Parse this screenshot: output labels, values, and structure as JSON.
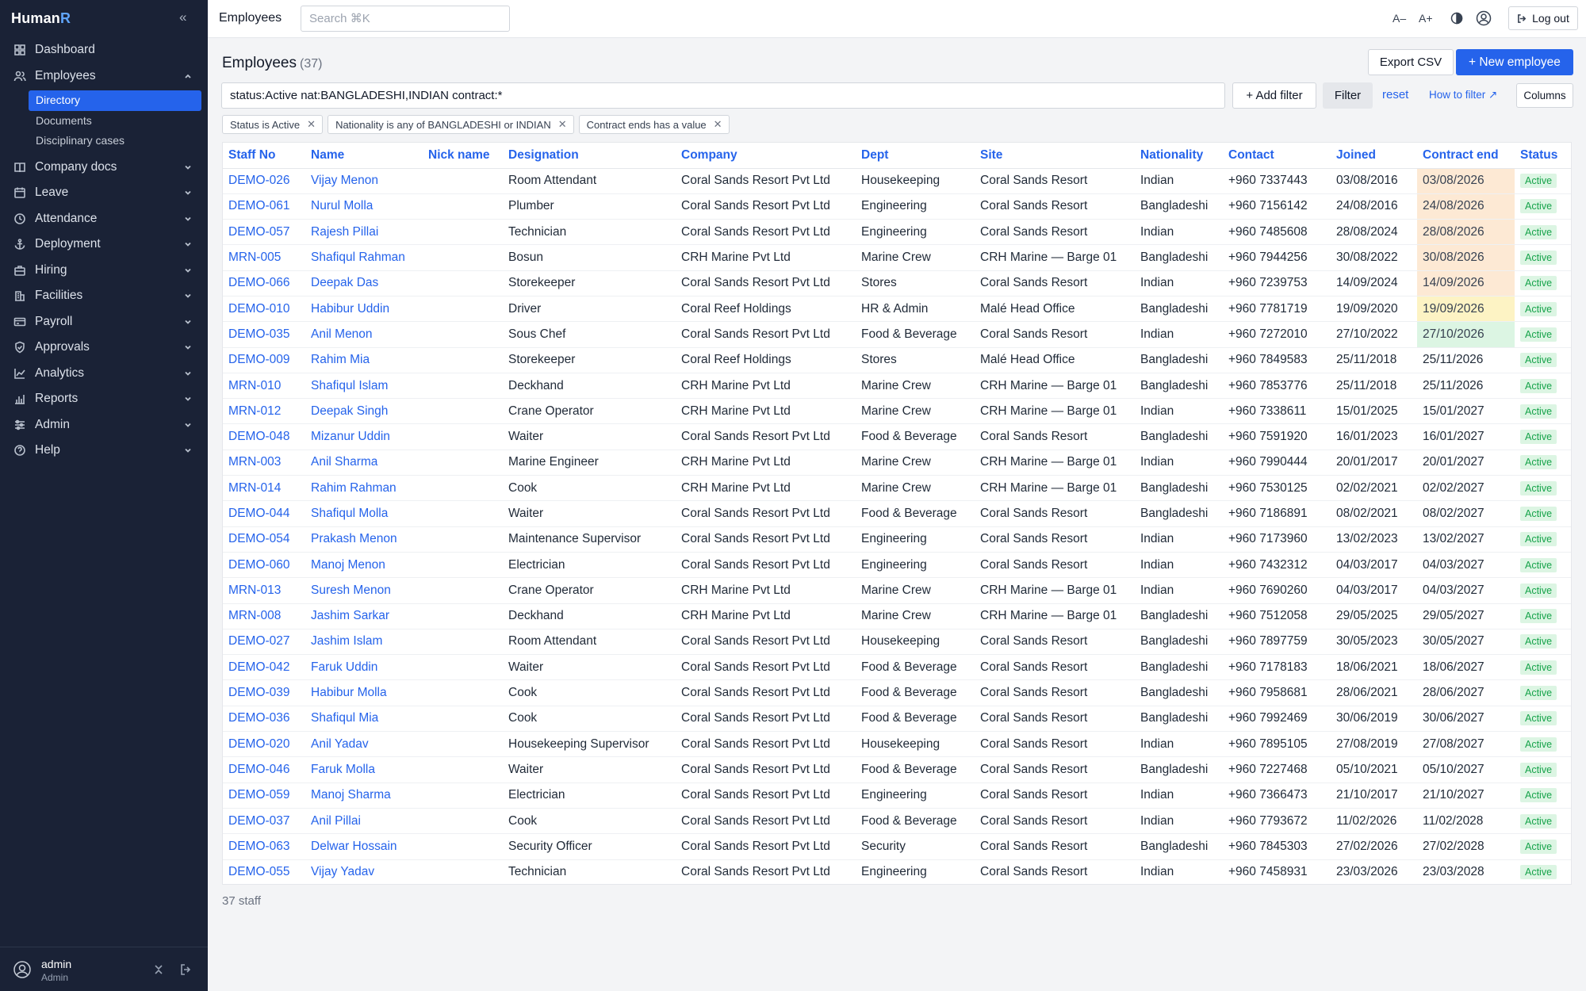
{
  "brand": {
    "name": "Human",
    "accent": "R"
  },
  "sidebar": {
    "items": [
      {
        "label": "Dashboard",
        "icon": "grid-icon",
        "expandable": false
      },
      {
        "label": "Employees",
        "icon": "users-icon",
        "expandable": true,
        "open": true
      },
      {
        "label": "Company docs",
        "icon": "book-icon",
        "expandable": true
      },
      {
        "label": "Leave",
        "icon": "calendar-icon",
        "expandable": true
      },
      {
        "label": "Attendance",
        "icon": "clock-icon",
        "expandable": true
      },
      {
        "label": "Deployment",
        "icon": "anchor-icon",
        "expandable": true
      },
      {
        "label": "Hiring",
        "icon": "briefcase-icon",
        "expandable": true
      },
      {
        "label": "Facilities",
        "icon": "building-icon",
        "expandable": true
      },
      {
        "label": "Payroll",
        "icon": "card-icon",
        "expandable": true
      },
      {
        "label": "Approvals",
        "icon": "shield-icon",
        "expandable": true
      },
      {
        "label": "Analytics",
        "icon": "chart-line-icon",
        "expandable": true
      },
      {
        "label": "Reports",
        "icon": "bar-chart-icon",
        "expandable": true
      },
      {
        "label": "Admin",
        "icon": "sliders-icon",
        "expandable": true
      },
      {
        "label": "Help",
        "icon": "help-icon",
        "expandable": true
      }
    ],
    "employee_subitems": [
      "Directory",
      "Documents",
      "Disciplinary cases"
    ],
    "active_subitem": "Directory",
    "user": {
      "name": "admin",
      "role": "Admin"
    }
  },
  "topbar": {
    "crumb": "Employees",
    "search_placeholder": "Search  ⌘K",
    "font_smaller": "A–",
    "font_larger": "A+",
    "logout_label": "Log out"
  },
  "page": {
    "title": "Employees",
    "count": "(37)",
    "export_label": "Export CSV",
    "new_label": "+ New employee",
    "query": "status:Active nat:BANGLADESHI,INDIAN contract:*",
    "add_filter_label": "+ Add filter",
    "filter_label": "Filter",
    "reset_label": "reset",
    "howto_label": "How to filter ↗",
    "columns_label": "Columns",
    "chips": [
      "Status is Active",
      "Nationality is any of BANGLADESHI or INDIAN",
      "Contract ends has a value"
    ],
    "footer": "37 staff"
  },
  "table": {
    "headers": [
      "Staff No",
      "Name",
      "Nick name",
      "Designation",
      "Company",
      "Dept",
      "Site",
      "Nationality",
      "Contact",
      "Joined",
      "Contract end",
      "Status"
    ],
    "rows": [
      [
        "DEMO-026",
        "Vijay Menon",
        "",
        "Room Attendant",
        "Coral Sands Resort Pvt Ltd",
        "Housekeeping",
        "Coral Sands Resort",
        "Indian",
        "+960 7337443",
        "03/08/2016",
        "03/08/2026",
        "Active",
        "orange"
      ],
      [
        "DEMO-061",
        "Nurul Molla",
        "",
        "Plumber",
        "Coral Sands Resort Pvt Ltd",
        "Engineering",
        "Coral Sands Resort",
        "Bangladeshi",
        "+960 7156142",
        "24/08/2016",
        "24/08/2026",
        "Active",
        "orange"
      ],
      [
        "DEMO-057",
        "Rajesh Pillai",
        "",
        "Technician",
        "Coral Sands Resort Pvt Ltd",
        "Engineering",
        "Coral Sands Resort",
        "Indian",
        "+960 7485608",
        "28/08/2024",
        "28/08/2026",
        "Active",
        "orange"
      ],
      [
        "MRN-005",
        "Shafiqul Rahman",
        "",
        "Bosun",
        "CRH Marine Pvt Ltd",
        "Marine Crew",
        "CRH Marine — Barge 01",
        "Bangladeshi",
        "+960 7944256",
        "30/08/2022",
        "30/08/2026",
        "Active",
        "orange"
      ],
      [
        "DEMO-066",
        "Deepak Das",
        "",
        "Storekeeper",
        "Coral Sands Resort Pvt Ltd",
        "Stores",
        "Coral Sands Resort",
        "Indian",
        "+960 7239753",
        "14/09/2024",
        "14/09/2026",
        "Active",
        "orange"
      ],
      [
        "DEMO-010",
        "Habibur Uddin",
        "",
        "Driver",
        "Coral Reef Holdings",
        "HR & Admin",
        "Malé Head Office",
        "Bangladeshi",
        "+960 7781719",
        "19/09/2020",
        "19/09/2026",
        "Active",
        "yellow"
      ],
      [
        "DEMO-035",
        "Anil Menon",
        "",
        "Sous Chef",
        "Coral Sands Resort Pvt Ltd",
        "Food & Beverage",
        "Coral Sands Resort",
        "Indian",
        "+960 7272010",
        "27/10/2022",
        "27/10/2026",
        "Active",
        "green"
      ],
      [
        "DEMO-009",
        "Rahim Mia",
        "",
        "Storekeeper",
        "Coral Reef Holdings",
        "Stores",
        "Malé Head Office",
        "Bangladeshi",
        "+960 7849583",
        "25/11/2018",
        "25/11/2026",
        "Active",
        ""
      ],
      [
        "MRN-010",
        "Shafiqul Islam",
        "",
        "Deckhand",
        "CRH Marine Pvt Ltd",
        "Marine Crew",
        "CRH Marine — Barge 01",
        "Bangladeshi",
        "+960 7853776",
        "25/11/2018",
        "25/11/2026",
        "Active",
        ""
      ],
      [
        "MRN-012",
        "Deepak Singh",
        "",
        "Crane Operator",
        "CRH Marine Pvt Ltd",
        "Marine Crew",
        "CRH Marine — Barge 01",
        "Indian",
        "+960 7338611",
        "15/01/2025",
        "15/01/2027",
        "Active",
        ""
      ],
      [
        "DEMO-048",
        "Mizanur Uddin",
        "",
        "Waiter",
        "Coral Sands Resort Pvt Ltd",
        "Food & Beverage",
        "Coral Sands Resort",
        "Bangladeshi",
        "+960 7591920",
        "16/01/2023",
        "16/01/2027",
        "Active",
        ""
      ],
      [
        "MRN-003",
        "Anil Sharma",
        "",
        "Marine Engineer",
        "CRH Marine Pvt Ltd",
        "Marine Crew",
        "CRH Marine — Barge 01",
        "Indian",
        "+960 7990444",
        "20/01/2017",
        "20/01/2027",
        "Active",
        ""
      ],
      [
        "MRN-014",
        "Rahim Rahman",
        "",
        "Cook",
        "CRH Marine Pvt Ltd",
        "Marine Crew",
        "CRH Marine — Barge 01",
        "Bangladeshi",
        "+960 7530125",
        "02/02/2021",
        "02/02/2027",
        "Active",
        ""
      ],
      [
        "DEMO-044",
        "Shafiqul Molla",
        "",
        "Waiter",
        "Coral Sands Resort Pvt Ltd",
        "Food & Beverage",
        "Coral Sands Resort",
        "Bangladeshi",
        "+960 7186891",
        "08/02/2021",
        "08/02/2027",
        "Active",
        ""
      ],
      [
        "DEMO-054",
        "Prakash Menon",
        "",
        "Maintenance Supervisor",
        "Coral Sands Resort Pvt Ltd",
        "Engineering",
        "Coral Sands Resort",
        "Indian",
        "+960 7173960",
        "13/02/2023",
        "13/02/2027",
        "Active",
        ""
      ],
      [
        "DEMO-060",
        "Manoj Menon",
        "",
        "Electrician",
        "Coral Sands Resort Pvt Ltd",
        "Engineering",
        "Coral Sands Resort",
        "Indian",
        "+960 7432312",
        "04/03/2017",
        "04/03/2027",
        "Active",
        ""
      ],
      [
        "MRN-013",
        "Suresh Menon",
        "",
        "Crane Operator",
        "CRH Marine Pvt Ltd",
        "Marine Crew",
        "CRH Marine — Barge 01",
        "Indian",
        "+960 7690260",
        "04/03/2017",
        "04/03/2027",
        "Active",
        ""
      ],
      [
        "MRN-008",
        "Jashim Sarkar",
        "",
        "Deckhand",
        "CRH Marine Pvt Ltd",
        "Marine Crew",
        "CRH Marine — Barge 01",
        "Bangladeshi",
        "+960 7512058",
        "29/05/2025",
        "29/05/2027",
        "Active",
        ""
      ],
      [
        "DEMO-027",
        "Jashim Islam",
        "",
        "Room Attendant",
        "Coral Sands Resort Pvt Ltd",
        "Housekeeping",
        "Coral Sands Resort",
        "Bangladeshi",
        "+960 7897759",
        "30/05/2023",
        "30/05/2027",
        "Active",
        ""
      ],
      [
        "DEMO-042",
        "Faruk Uddin",
        "",
        "Waiter",
        "Coral Sands Resort Pvt Ltd",
        "Food & Beverage",
        "Coral Sands Resort",
        "Bangladeshi",
        "+960 7178183",
        "18/06/2021",
        "18/06/2027",
        "Active",
        ""
      ],
      [
        "DEMO-039",
        "Habibur Molla",
        "",
        "Cook",
        "Coral Sands Resort Pvt Ltd",
        "Food & Beverage",
        "Coral Sands Resort",
        "Bangladeshi",
        "+960 7958681",
        "28/06/2021",
        "28/06/2027",
        "Active",
        ""
      ],
      [
        "DEMO-036",
        "Shafiqul Mia",
        "",
        "Cook",
        "Coral Sands Resort Pvt Ltd",
        "Food & Beverage",
        "Coral Sands Resort",
        "Bangladeshi",
        "+960 7992469",
        "30/06/2019",
        "30/06/2027",
        "Active",
        ""
      ],
      [
        "DEMO-020",
        "Anil Yadav",
        "",
        "Housekeeping Supervisor",
        "Coral Sands Resort Pvt Ltd",
        "Housekeeping",
        "Coral Sands Resort",
        "Indian",
        "+960 7895105",
        "27/08/2019",
        "27/08/2027",
        "Active",
        ""
      ],
      [
        "DEMO-046",
        "Faruk Molla",
        "",
        "Waiter",
        "Coral Sands Resort Pvt Ltd",
        "Food & Beverage",
        "Coral Sands Resort",
        "Bangladeshi",
        "+960 7227468",
        "05/10/2021",
        "05/10/2027",
        "Active",
        ""
      ],
      [
        "DEMO-059",
        "Manoj Sharma",
        "",
        "Electrician",
        "Coral Sands Resort Pvt Ltd",
        "Engineering",
        "Coral Sands Resort",
        "Indian",
        "+960 7366473",
        "21/10/2017",
        "21/10/2027",
        "Active",
        ""
      ],
      [
        "DEMO-037",
        "Anil Pillai",
        "",
        "Cook",
        "Coral Sands Resort Pvt Ltd",
        "Food & Beverage",
        "Coral Sands Resort",
        "Indian",
        "+960 7793672",
        "11/02/2026",
        "11/02/2028",
        "Active",
        ""
      ],
      [
        "DEMO-063",
        "Delwar Hossain",
        "",
        "Security Officer",
        "Coral Sands Resort Pvt Ltd",
        "Security",
        "Coral Sands Resort",
        "Bangladeshi",
        "+960 7845303",
        "27/02/2026",
        "27/02/2028",
        "Active",
        ""
      ],
      [
        "DEMO-055",
        "Vijay Yadav",
        "",
        "Technician",
        "Coral Sands Resort Pvt Ltd",
        "Engineering",
        "Coral Sands Resort",
        "Indian",
        "+960 7458931",
        "23/03/2026",
        "23/03/2028",
        "Active",
        ""
      ]
    ]
  },
  "colors": {
    "sidebar_bg": "#1a2236",
    "accent": "#2563eb",
    "status_active_bg": "#dcf5e3",
    "status_active_fg": "#16a34a"
  }
}
